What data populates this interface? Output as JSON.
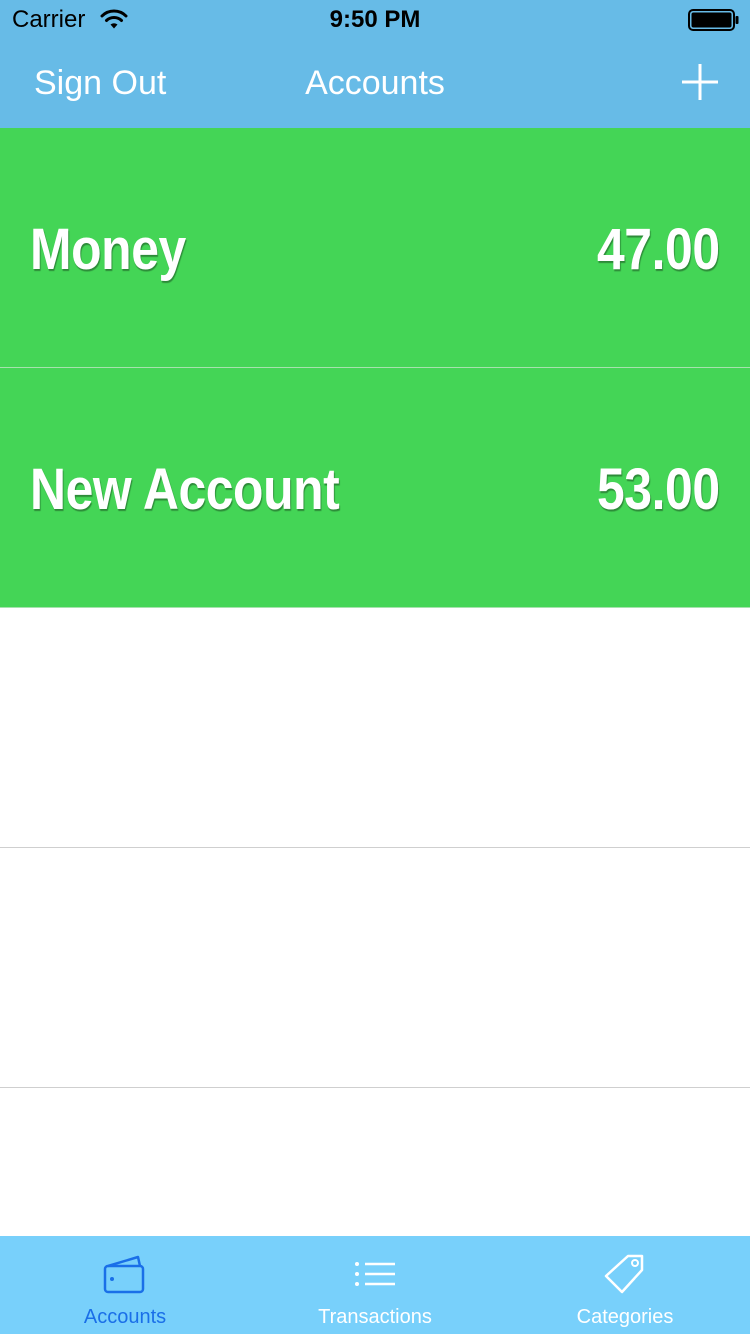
{
  "status_bar": {
    "carrier": "Carrier",
    "time": "9:50 PM",
    "wifi_icon": "wifi-icon",
    "battery_icon": "battery-full-icon"
  },
  "nav": {
    "left_button": "Sign Out",
    "title": "Accounts",
    "right_icon": "plus-icon"
  },
  "accounts": [
    {
      "name": "Money",
      "amount": "47.00"
    },
    {
      "name": "New Account",
      "amount": "53.00"
    }
  ],
  "tabs": [
    {
      "label": "Accounts",
      "icon": "wallet-icon",
      "selected": true
    },
    {
      "label": "Transactions",
      "icon": "list-icon",
      "selected": false
    },
    {
      "label": "Categories",
      "icon": "tag-icon",
      "selected": false
    }
  ],
  "colors": {
    "header_bg": "#67bbe7",
    "row_fill": "#44d556",
    "tab_bar_bg": "#78d0fb",
    "tab_selected": "#1a6fe8",
    "tab_unselected": "#ffffff"
  }
}
